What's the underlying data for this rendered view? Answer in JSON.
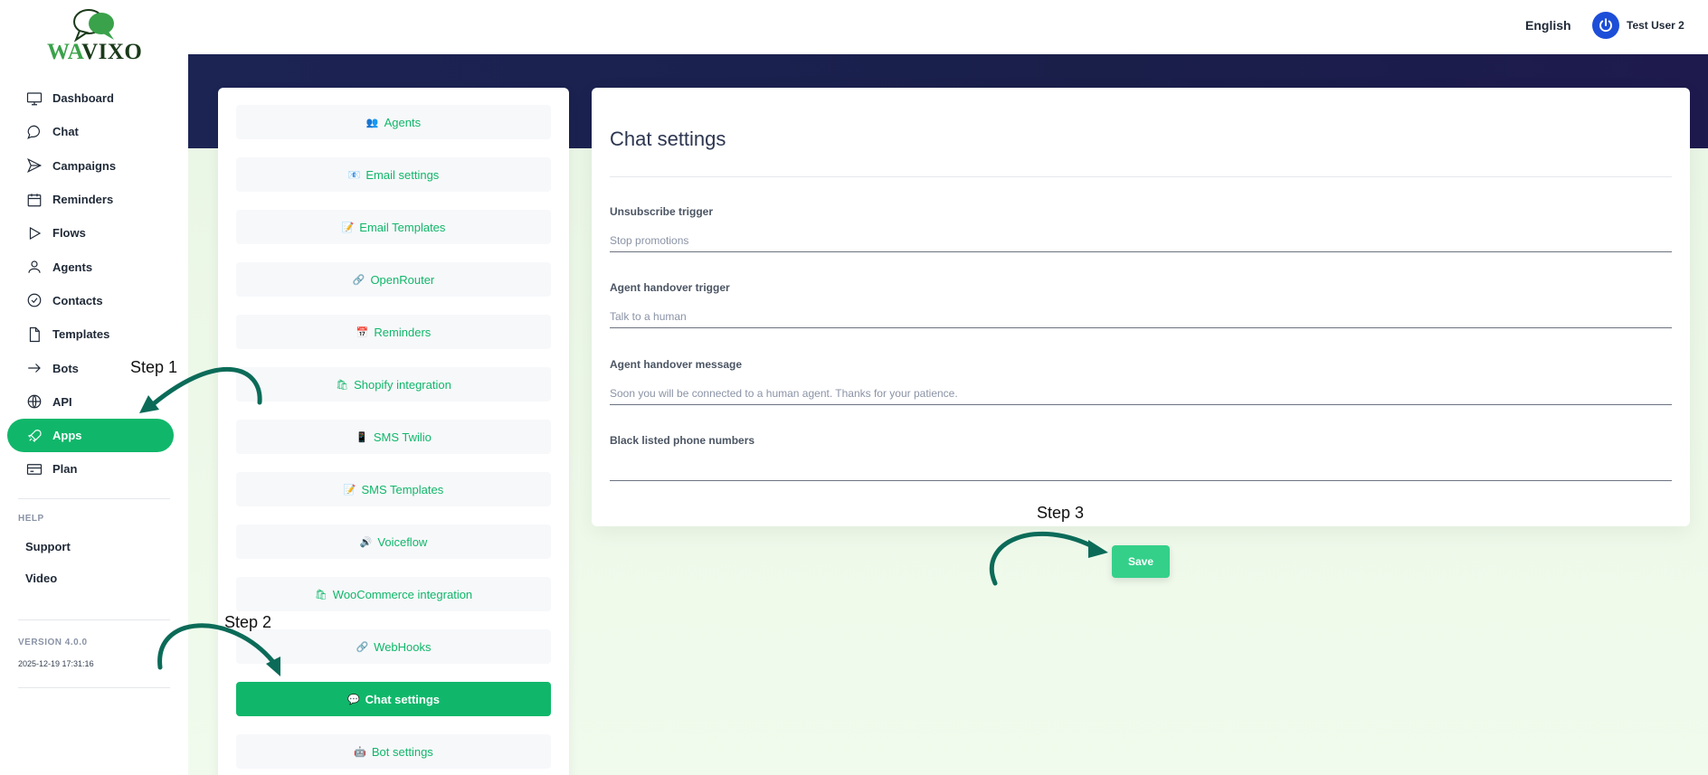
{
  "brand": {
    "logo_wa": "WA",
    "logo_vixo": "VIXO"
  },
  "header": {
    "language": "English",
    "user_name": "Test User 2"
  },
  "sidebar": {
    "items": [
      {
        "label": "Dashboard",
        "icon": "monitor-icon"
      },
      {
        "label": "Chat",
        "icon": "chat-bubble-icon"
      },
      {
        "label": "Campaigns",
        "icon": "send-icon"
      },
      {
        "label": "Reminders",
        "icon": "calendar-icon"
      },
      {
        "label": "Flows",
        "icon": "play-icon"
      },
      {
        "label": "Agents",
        "icon": "user-icon"
      },
      {
        "label": "Contacts",
        "icon": "check-circle-icon"
      },
      {
        "label": "Templates",
        "icon": "file-icon"
      },
      {
        "label": "Bots",
        "icon": "arrow-right-icon"
      },
      {
        "label": "API",
        "icon": "globe-icon"
      },
      {
        "label": "Apps",
        "icon": "rocket-icon",
        "active": true
      },
      {
        "label": "Plan",
        "icon": "credit-card-icon"
      }
    ],
    "help_title": "HELP",
    "help_links": [
      "Support",
      "Video"
    ],
    "version": "VERSION 4.0.0",
    "build_date": "2025-12-19 17:31:16"
  },
  "apps": {
    "items": [
      {
        "label": "Agents",
        "emoji": "👥"
      },
      {
        "label": "Email settings",
        "emoji": "📧"
      },
      {
        "label": "Email Templates",
        "emoji": "📝"
      },
      {
        "label": "OpenRouter",
        "emoji": "🔗"
      },
      {
        "label": "Reminders",
        "emoji": "📅"
      },
      {
        "label": "Shopify integration",
        "emoji": "🛍"
      },
      {
        "label": "SMS Twilio",
        "emoji": "📱"
      },
      {
        "label": "SMS Templates",
        "emoji": "📝"
      },
      {
        "label": "Voiceflow",
        "emoji": "🔊"
      },
      {
        "label": "WooCommerce integration",
        "emoji": "🛍"
      },
      {
        "label": "WebHooks",
        "emoji": "🔗"
      },
      {
        "label": "Chat settings",
        "emoji": "💬",
        "active": true
      },
      {
        "label": "Bot settings",
        "emoji": "🤖"
      }
    ]
  },
  "chat_settings": {
    "title": "Chat settings",
    "fields": [
      {
        "label": "Unsubscribe trigger",
        "placeholder": "Stop promotions"
      },
      {
        "label": "Agent handover trigger",
        "placeholder": "Talk to a human"
      },
      {
        "label": "Agent handover message",
        "placeholder": "Soon you will be connected to a human agent. Thanks for your patience."
      },
      {
        "label": "Black listed phone numbers",
        "placeholder": ""
      }
    ],
    "save_label": "Save"
  },
  "annotations": {
    "step1": "Step 1",
    "step2": "Step 2",
    "step3": "Step 3"
  },
  "colors": {
    "accent": "#10b76a",
    "save": "#34d08a",
    "banner": "#1c2454",
    "arrow": "#0b6b58"
  }
}
